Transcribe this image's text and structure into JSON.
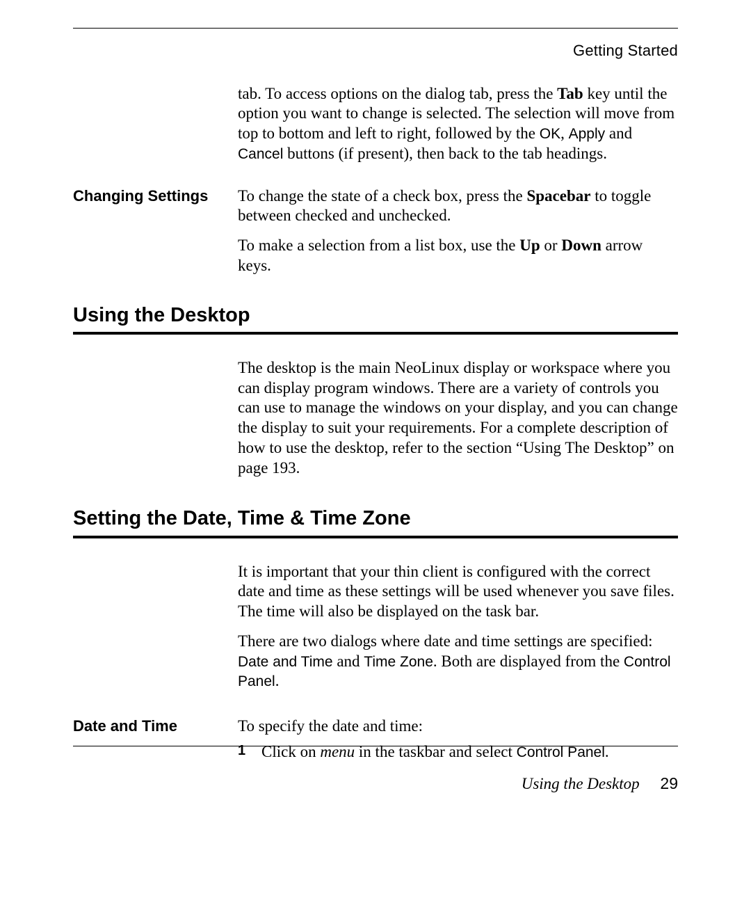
{
  "header": {
    "breadcrumb": "Getting Started"
  },
  "intro_paragraph": {
    "p1_a": "tab. To access options on the dialog tab, press the ",
    "p1_tab": "Tab",
    "p1_b": " key until the option you want to change is selected. The selection will move from top to bottom and left to right, followed by the ",
    "p1_ok": "OK",
    "p1_sep1": ", ",
    "p1_apply": "Apply",
    "p1_sep2": " and ",
    "p1_cancel": "Cancel",
    "p1_c": " buttons (if present), then back to the tab headings."
  },
  "changing_settings": {
    "label": "Changing Settings",
    "p1_a": "To change the state of a check box, press the ",
    "p1_space": "Spacebar",
    "p1_b": " to toggle between checked and unchecked.",
    "p2_a": "To make a selection from a list box, use the ",
    "p2_up": "Up",
    "p2_or": " or ",
    "p2_down": "Down",
    "p2_b": " arrow keys."
  },
  "using_desktop": {
    "heading": "Using the Desktop",
    "p1": "The desktop is the main NeoLinux display or workspace where you can display program windows. There are a variety of controls you can use to manage the windows on your display, and you can change the display to suit your requirements. For a complete description of how to use the desktop, refer to the section “Using The Desktop” on page 193."
  },
  "setting_dtz": {
    "heading": "Setting the Date, Time & Time Zone",
    "p1": "It is important that your thin client is configured with the correct date and time as these settings will be used whenever you save files. The time will also be displayed on the task bar.",
    "p2_a": "There are two dialogs where date and time settings are specified: ",
    "p2_dlg1": "Date and Time",
    "p2_mid": " and ",
    "p2_dlg2": "Time Zone",
    "p2_b": ". Both are displayed from the ",
    "p2_cp": "Control Panel",
    "p2_end": "."
  },
  "date_time": {
    "label": "Date and Time",
    "intro": "To specify the date and time:",
    "step_num": "1",
    "step_a": "Click on ",
    "step_menu": "menu",
    "step_b": " in the taskbar and select ",
    "step_cp": "Control Panel",
    "step_end": "."
  },
  "footer": {
    "section": "Using the Desktop",
    "page": "29"
  }
}
